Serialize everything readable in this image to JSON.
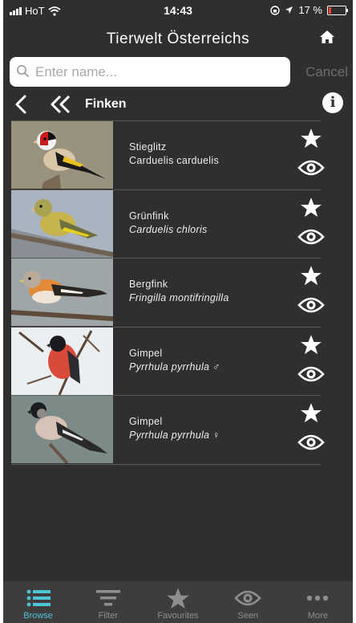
{
  "status_bar": {
    "carrier": "HoT",
    "time": "14:43",
    "battery": "17 %",
    "battery_level": 0.17,
    "icons": [
      "signal-icon",
      "wifi-icon",
      "screen-lock-icon",
      "location-arrow-icon",
      "battery-icon"
    ]
  },
  "header": {
    "title": "Tierwelt Österreichs",
    "home_icon": "home-icon"
  },
  "search": {
    "placeholder": "Enter name...",
    "value": "",
    "cancel_label": "Cancel",
    "icon": "search-icon"
  },
  "nav": {
    "current": "Finken",
    "back_icon": "chevron-left-icon",
    "back_to_top_icon": "double-chevron-left-icon",
    "info_icon": "info-icon"
  },
  "birds": [
    {
      "common": "Stieglitz",
      "latin": "Carduelis carduelis",
      "latin_italic": false
    },
    {
      "common": "Grünfink",
      "latin": "Carduelis chloris",
      "latin_italic": true
    },
    {
      "common": "Bergfink",
      "latin": "Fringilla montifringilla",
      "latin_italic": true
    },
    {
      "common": "Gimpel",
      "latin": "Pyrrhula pyrrhula ♂",
      "latin_italic": true
    },
    {
      "common": "Gimpel",
      "latin": "Pyrrhula pyrrhula ♀",
      "latin_italic": true
    }
  ],
  "tabs": [
    {
      "label": "Browse",
      "icon": "list-icon",
      "active": true
    },
    {
      "label": "Filter",
      "icon": "filter-icon",
      "active": false
    },
    {
      "label": "Favourites",
      "icon": "star-icon",
      "active": false
    },
    {
      "label": "Seen",
      "icon": "eye-icon",
      "active": false
    },
    {
      "label": "More",
      "icon": "more-dots-icon",
      "active": false
    }
  ],
  "colors": {
    "background": "#2f2f2f",
    "tab_bar": "#3d3d3d",
    "active_tab": "#4ec3d4",
    "inactive_tab": "#8e8e8e",
    "divider": "#5a5a5a"
  }
}
